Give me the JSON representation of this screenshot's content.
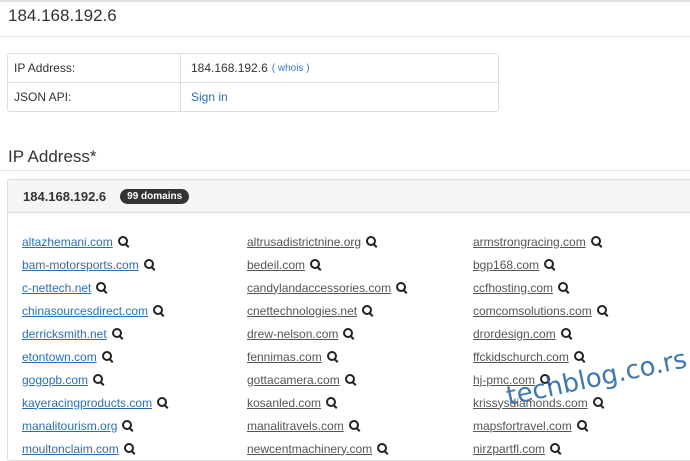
{
  "page": {
    "title": "184.168.192.6"
  },
  "info": {
    "rows": [
      {
        "label": "IP Address:",
        "value": "184.168.192.6",
        "whois_label": "( whois )"
      },
      {
        "label": "JSON API:",
        "value": "Sign in"
      }
    ]
  },
  "section": {
    "title": "IP Address*"
  },
  "panel": {
    "ip": "184.168.192.6",
    "badge": "99 domains",
    "domains": [
      "altazhemani.com",
      "altrusadistrictnine.org",
      "armstrongracing.com",
      "bam-motorsports.com",
      "bedeil.com",
      "bgp168.com",
      "c-nettech.net",
      "candylandaccessories.com",
      "ccfhosting.com",
      "chinasourcesdirect.com",
      "cnettechnologies.net",
      "comcomsolutions.com",
      "derricksmith.net",
      "drew-nelson.com",
      "drordesign.com",
      "etontown.com",
      "fennimas.com",
      "ffckidschurch.com",
      "gogopb.com",
      "gottacamera.com",
      "hj-pmc.com",
      "kayeracingproducts.com",
      "kosanled.com",
      "krissysdiamonds.com",
      "manalitourism.org",
      "manalitravels.com",
      "mapsfortravel.com",
      "moultonclaim.com",
      "newcentmachinery.com",
      "nirzpartfl.com"
    ]
  },
  "watermark": "techblog.co.rs",
  "colors": {
    "link_blue": "#2a6fb5",
    "link_gray": "#555555",
    "badge_bg": "#333333"
  }
}
